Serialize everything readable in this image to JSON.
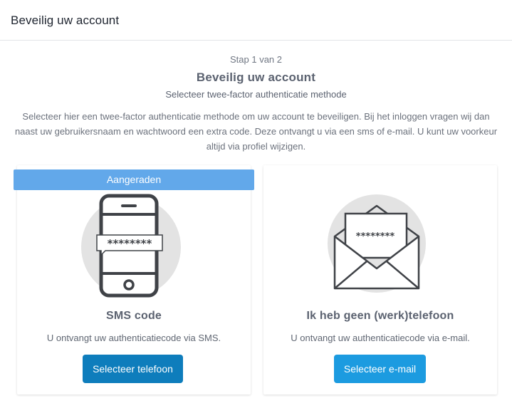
{
  "header": {
    "title": "Beveilig uw account"
  },
  "main": {
    "step": "Stap 1 van 2",
    "title": "Beveilig uw account",
    "subtitle": "Selecteer twee-factor authenticatie methode",
    "description": "Selecteer hier een twee-factor authenticatie methode om uw account te beveiligen. Bij het inloggen vragen wij dan naast uw gebruikersnaam en wachtwoord een extra code. Deze ontvangt u via een sms of e-mail. U kunt uw voorkeur altijd via profiel wijzigen."
  },
  "options": {
    "sms": {
      "badge": "Aangeraden",
      "code": "********",
      "title": "SMS code",
      "text": "U ontvangt uw authenticatiecode via SMS.",
      "button": "Selecteer telefoon",
      "icon": "phone-icon"
    },
    "email": {
      "code": "********",
      "title": "Ik heb geen (werk)telefoon",
      "text": "U ontvangt uw authenticatiecode via e-mail.",
      "button": "Selecteer e-mail",
      "icon": "envelope-icon"
    }
  },
  "colors": {
    "badge": "#62a8ea",
    "sms_button": "#0e7dbc",
    "email_button": "#1c9be0",
    "illustration_bg": "#e3e3e3",
    "illustration_stroke": "#3f4247"
  }
}
